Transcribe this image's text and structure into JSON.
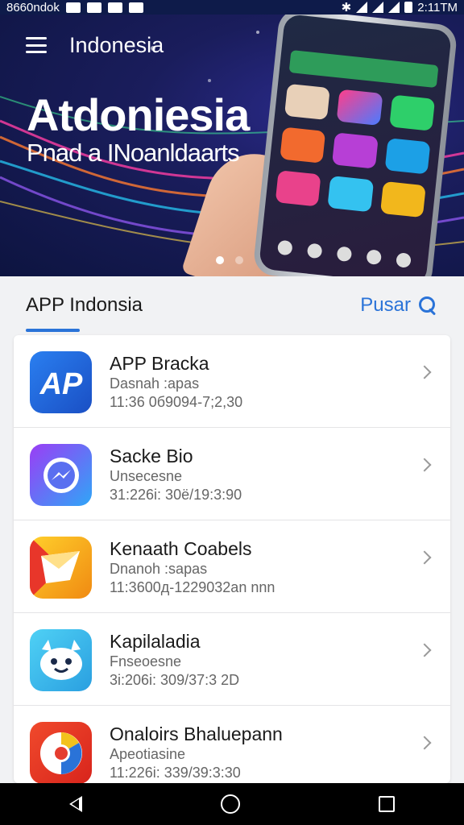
{
  "status_bar": {
    "left_text": "8660ndok",
    "time": "2:11TM"
  },
  "header": {
    "menu_icon": "menu-icon",
    "title": "Indonesia"
  },
  "hero": {
    "title": "Atdoniesia",
    "subtitle": "Pnad a INoanldaarts",
    "carousel": {
      "current_slide": 1,
      "total_slides": 2
    }
  },
  "section": {
    "title": "APP Indonsia",
    "action_label": "Pusar",
    "action_icon": "search-icon",
    "accent_color": "#2a73d8"
  },
  "apps": [
    {
      "name": "APP Bracka",
      "subtitle": "Dasnah :apas",
      "meta": "11:36 0б9094-7;2,30",
      "icon": "app-logo-icon",
      "color": "#1f63d3"
    },
    {
      "name": "Sacke Bio",
      "subtitle": "Unsecesne",
      "meta": "31:226і: 30ё/19:3:90",
      "icon": "messenger-icon",
      "color": "#6b4de6"
    },
    {
      "name": "Kenaath Coabels",
      "subtitle": "Dnanoh :sapas",
      "meta": "11:3600д-1229032аn nnn",
      "icon": "envelope-icon",
      "color": "#f5b21a"
    },
    {
      "name": "Kapilaladia",
      "subtitle": "Fnseoesne",
      "meta": "3і:206і: 309/37:3 2D",
      "icon": "character-icon",
      "color": "#3cb3e6"
    },
    {
      "name": "Onaloirs Bhaluepann",
      "subtitle": "Apeotiasine",
      "meta": "11:226і: 339/39:3:30",
      "icon": "chrome-style-icon",
      "color": "#e53d2f"
    }
  ],
  "nav": {
    "back_icon": "back-icon",
    "home_icon": "home-icon",
    "recent_icon": "recent-apps-icon"
  }
}
